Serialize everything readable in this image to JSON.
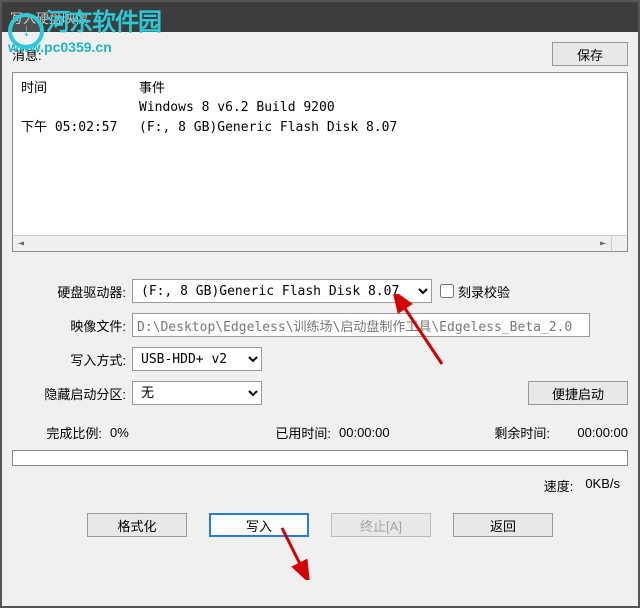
{
  "titlebar": {
    "title": "写入硬盘映像"
  },
  "watermark": {
    "line1": "河东软件园",
    "line2": "www.pc0359.cn"
  },
  "msg": {
    "label": "消息:",
    "save_btn": "保存"
  },
  "log": {
    "header_time": "时间",
    "header_event": "事件",
    "rows": [
      {
        "time": "",
        "event": "Windows 8 v6.2 Build 9200"
      },
      {
        "time": "下午 05:02:57",
        "event": "(F:, 8 GB)Generic Flash Disk     8.07"
      }
    ]
  },
  "form": {
    "drive_label": "硬盘驱动器:",
    "drive_value": "(F:, 8 GB)Generic Flash Disk     8.07",
    "verify_label": "刻录校验",
    "image_label": "映像文件:",
    "image_value": "D:\\Desktop\\Edgeless\\训练场\\启动盘制作工具\\Edgeless_Beta_2.0",
    "write_mode_label": "写入方式:",
    "write_mode_value": "USB-HDD+ v2",
    "hide_part_label": "隐藏启动分区:",
    "hide_part_value": "无",
    "easy_boot_btn": "便捷启动"
  },
  "stats": {
    "percent_label": "完成比例:",
    "percent_value": "0%",
    "elapsed_label": "已用时间:",
    "elapsed_value": "00:00:00",
    "remain_label": "剩余时间:",
    "remain_value": "00:00:00",
    "speed_label": "速度:",
    "speed_value": "0KB/s"
  },
  "buttons": {
    "format": "格式化",
    "write": "写入",
    "stop": "终止[A]",
    "return": "返回"
  }
}
